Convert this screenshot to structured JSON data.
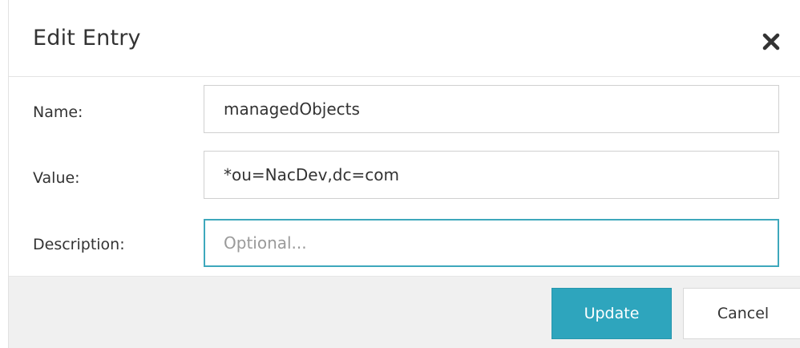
{
  "dialog": {
    "title": "Edit Entry"
  },
  "form": {
    "name_label": "Name:",
    "name_value": "managedObjects",
    "value_label": "Value:",
    "value_value": "*ou=NacDev,dc=com",
    "description_label": "Description:",
    "description_value": "",
    "description_placeholder": "Optional..."
  },
  "footer": {
    "update_label": "Update",
    "cancel_label": "Cancel"
  },
  "colors": {
    "accent": "#2ea5bd",
    "focus_border": "#3ea8bc",
    "footer_bg": "#f0f0f0",
    "text": "#333333"
  },
  "icons": {
    "close": "close-icon"
  }
}
